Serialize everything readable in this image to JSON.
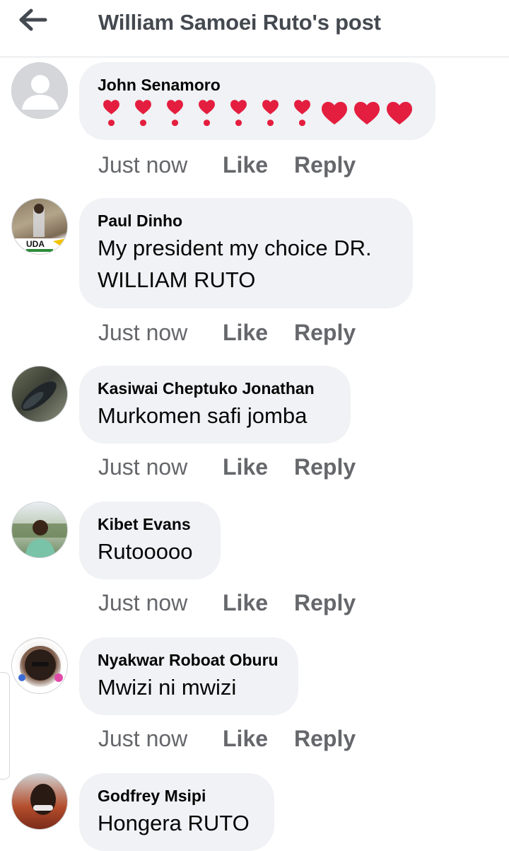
{
  "header": {
    "title": "William Samoei Ruto's post",
    "back_icon": "arrow-left-icon"
  },
  "colors": {
    "bubble_bg": "#f0f2f5",
    "meta_text": "#65676b",
    "heart_red": "#e41e3f"
  },
  "comments": [
    {
      "author": "John Senamoro",
      "text": "",
      "emoji": [
        "heavy-heart-exclamation-icon",
        "heavy-heart-exclamation-icon",
        "heavy-heart-exclamation-icon",
        "heavy-heart-exclamation-icon",
        "heavy-heart-exclamation-icon",
        "heavy-heart-exclamation-icon",
        "heavy-heart-exclamation-icon",
        "red-heart-icon",
        "red-heart-icon",
        "red-heart-icon"
      ],
      "time": "Just now",
      "like": "Like",
      "reply": "Reply",
      "avatar": "default-avatar-icon"
    },
    {
      "author": "Paul Dinho",
      "text": "My president my choice DR. WILLIAM RUTO",
      "time": "Just now",
      "like": "Like",
      "reply": "Reply",
      "avatar": "photo-avatar",
      "avatar_badge": "UDA"
    },
    {
      "author": "Kasiwai Cheptuko Jonathan",
      "text": "Murkomen safi jomba",
      "time": "Just now",
      "like": "Like",
      "reply": "Reply",
      "avatar": "photo-avatar"
    },
    {
      "author": "Kibet Evans",
      "text": "Rutooooo",
      "time": "Just now",
      "like": "Like",
      "reply": "Reply",
      "avatar": "photo-avatar"
    },
    {
      "author": "Nyakwar Roboat Oburu",
      "text": "Mwizi ni mwizi",
      "time": "Just now",
      "like": "Like",
      "reply": "Reply",
      "avatar": "photo-avatar"
    },
    {
      "author": "Godfrey Msipi",
      "text": "Hongera RUTO",
      "time": "",
      "like": "",
      "reply": "",
      "avatar": "photo-avatar"
    }
  ]
}
